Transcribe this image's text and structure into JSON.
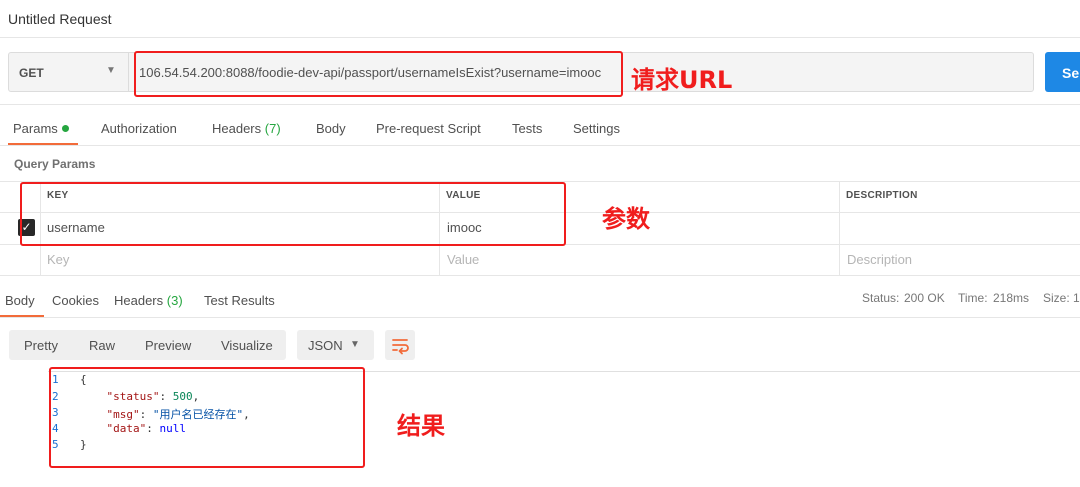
{
  "window": {
    "title": "Untitled Request"
  },
  "request": {
    "method": "GET",
    "url": "106.54.54.200:8088/foodie-dev-api/passport/usernameIsExist?username=imooc",
    "send_label": "Se"
  },
  "annotations": {
    "url": "请求URL",
    "params": "参数",
    "result": "结果"
  },
  "tabs": [
    {
      "label": "Params",
      "badge": ""
    },
    {
      "label": "Authorization",
      "badge": ""
    },
    {
      "label": "Headers",
      "badge": "(7)"
    },
    {
      "label": "Body",
      "badge": ""
    },
    {
      "label": "Pre-request Script",
      "badge": ""
    },
    {
      "label": "Tests",
      "badge": ""
    },
    {
      "label": "Settings",
      "badge": ""
    }
  ],
  "query_params": {
    "section_title": "Query Params",
    "headers": {
      "key": "KEY",
      "value": "VALUE",
      "description": "DESCRIPTION"
    },
    "rows": [
      {
        "key": "username",
        "value": "imooc",
        "checked": true
      }
    ],
    "placeholders": {
      "key": "Key",
      "value": "Value",
      "description": "Description"
    }
  },
  "response": {
    "tabs": [
      {
        "label": "Body",
        "badge": ""
      },
      {
        "label": "Cookies",
        "badge": ""
      },
      {
        "label": "Headers",
        "badge": "(3)"
      },
      {
        "label": "Test Results",
        "badge": ""
      }
    ],
    "status_label": "Status:",
    "status_value": "200 OK",
    "time_label": "Time:",
    "time_value": "218ms",
    "size_label": "Size:",
    "size_value": "1"
  },
  "view_toolbar": {
    "modes": [
      "Pretty",
      "Raw",
      "Preview",
      "Visualize"
    ],
    "format": "JSON"
  },
  "code": {
    "line_numbers": [
      "1",
      "2",
      "3",
      "4",
      "5"
    ],
    "open_brace": "{",
    "close_brace": "}",
    "fields": [
      {
        "key": "\"status\"",
        "value": "500",
        "trail": ","
      },
      {
        "key": "\"msg\"",
        "value": "\"用户名已经存在\"",
        "trail": ","
      },
      {
        "key": "\"data\"",
        "value": "null",
        "trail": ""
      }
    ]
  },
  "colors": {
    "accent_orange": "#f26b3a",
    "send_blue": "#1e88e5",
    "annotation_red": "#f01d1d",
    "success_green": "#26a640"
  }
}
